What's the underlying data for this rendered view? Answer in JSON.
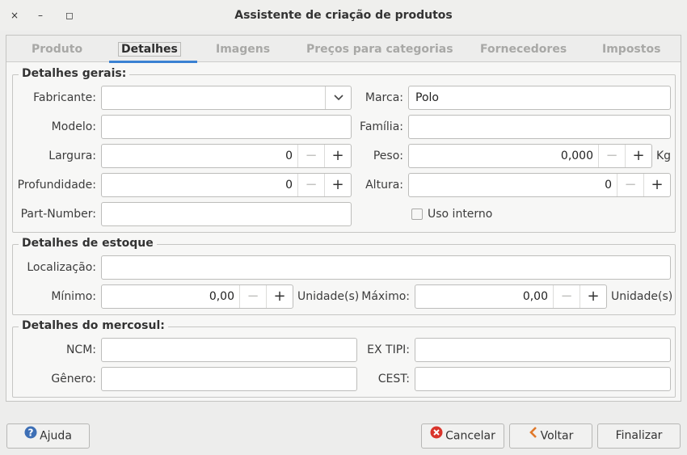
{
  "window": {
    "title": "Assistente de criação de produtos",
    "close_glyph": "×",
    "minimize_glyph": "–",
    "maximize_glyph": "◻"
  },
  "tabs": [
    {
      "label": "Produto",
      "active": false
    },
    {
      "label": "Detalhes",
      "active": true
    },
    {
      "label": "Imagens",
      "active": false
    },
    {
      "label": "Preços para categorias",
      "active": false
    },
    {
      "label": "Fornecedores",
      "active": false
    },
    {
      "label": "Impostos",
      "active": false
    }
  ],
  "general": {
    "title": "Detalhes gerais:",
    "fabricante_label": "Fabricante:",
    "fabricante_value": "",
    "marca_label": "Marca:",
    "marca_value": "Polo",
    "modelo_label": "Modelo:",
    "modelo_value": "",
    "familia_label": "Família:",
    "familia_value": "",
    "largura_label": "Largura:",
    "largura_value": "0",
    "peso_label": "Peso:",
    "peso_value": "0,000",
    "peso_unit": "Kg",
    "profundidade_label": "Profundidade:",
    "profundidade_value": "0",
    "altura_label": "Altura:",
    "altura_value": "0",
    "partnumber_label": "Part-Number:",
    "partnumber_value": "",
    "uso_interno_label": "Uso interno",
    "uso_interno_checked": false
  },
  "stock": {
    "title": "Detalhes de estoque",
    "localizacao_label": "Localização:",
    "localizacao_value": "",
    "minimo_label": "Mínimo:",
    "minimo_value": "0,00",
    "minimo_unit": "Unidade(s)",
    "maximo_label": "Máximo:",
    "maximo_value": "0,00",
    "maximo_unit": "Unidade(s)"
  },
  "mercosul": {
    "title": "Detalhes do mercosul:",
    "ncm_label": "NCM:",
    "ncm_value": "",
    "extipi_label": "EX TIPI:",
    "extipi_value": "",
    "genero_label": "Gênero:",
    "genero_value": "",
    "cest_label": "CEST:",
    "cest_value": ""
  },
  "spin": {
    "minus": "−",
    "plus": "+"
  },
  "buttons": {
    "help": "Ajuda",
    "cancel": "Cancelar",
    "back": "Voltar",
    "finish": "Finalizar"
  },
  "colors": {
    "accent": "#3a81d3",
    "help_icon": "#3d6fb5",
    "cancel_icon": "#d9342b",
    "back_icon": "#e0782a"
  }
}
